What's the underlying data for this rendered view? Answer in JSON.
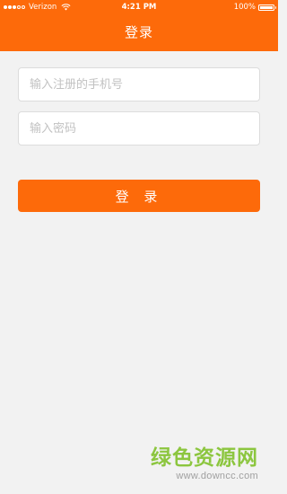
{
  "status_bar": {
    "carrier": "Verizon",
    "time": "4:21 PM",
    "battery": "100%",
    "signal_bars_filled": 3,
    "signal_bars_total": 5
  },
  "header": {
    "title": "登录"
  },
  "form": {
    "phone_placeholder": "输入注册的手机号",
    "phone_value": "",
    "password_placeholder": "输入密码",
    "password_value": "",
    "login_label": "登 录"
  },
  "watermark": {
    "title": "绿色资源网",
    "url": "www.downcc.com"
  },
  "colors": {
    "accent": "#fd6a0a",
    "background": "#f2f2f2",
    "watermark": "#8cc63f"
  },
  "icons": {
    "signal": "signal-dots-icon",
    "wifi": "wifi-icon",
    "battery": "battery-icon"
  }
}
